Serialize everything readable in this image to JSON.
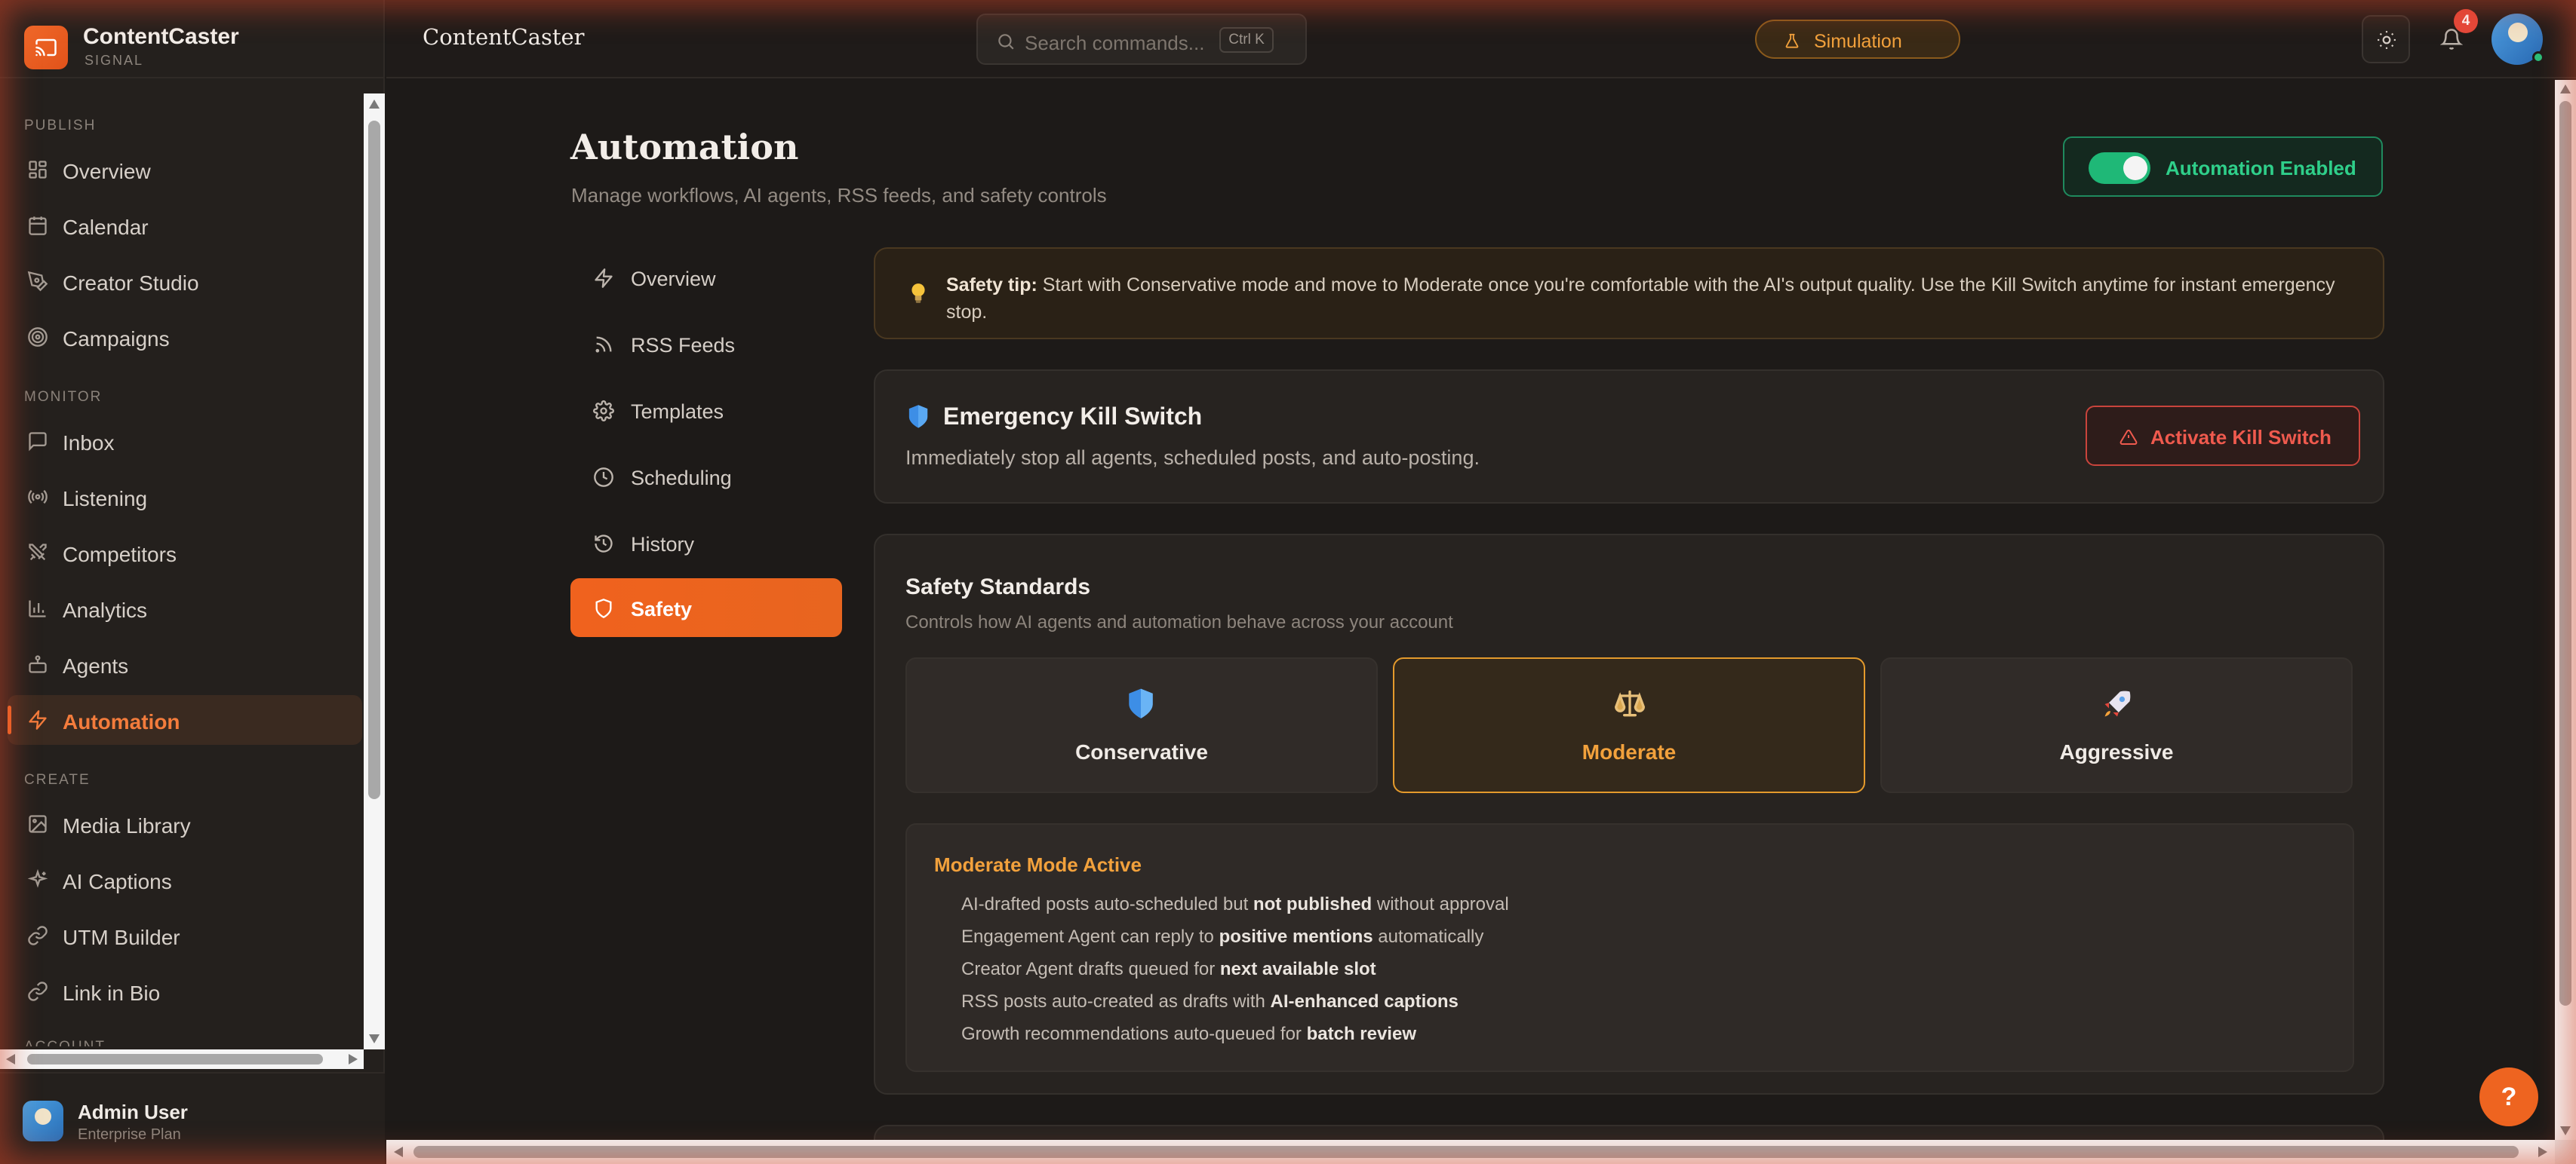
{
  "brand": {
    "name": "ContentCaster",
    "subtitle": "SIGNAL"
  },
  "sidebar": {
    "sections": [
      {
        "label": "PUBLISH"
      },
      {
        "label": "MONITOR"
      },
      {
        "label": "CREATE"
      },
      {
        "label": "ACCOUNT"
      }
    ],
    "items": [
      {
        "label": "Overview",
        "icon": "layout-grid-icon"
      },
      {
        "label": "Calendar",
        "icon": "calendar-icon"
      },
      {
        "label": "Creator Studio",
        "icon": "pen-tool-icon"
      },
      {
        "label": "Campaigns",
        "icon": "target-icon"
      },
      {
        "label": "Inbox",
        "icon": "message-square-icon"
      },
      {
        "label": "Listening",
        "icon": "radio-icon"
      },
      {
        "label": "Competitors",
        "icon": "swords-icon"
      },
      {
        "label": "Analytics",
        "icon": "bar-chart-icon"
      },
      {
        "label": "Agents",
        "icon": "bot-icon"
      },
      {
        "label": "Automation",
        "icon": "zap-icon",
        "active": true
      },
      {
        "label": "Media Library",
        "icon": "image-icon"
      },
      {
        "label": "AI Captions",
        "icon": "sparkles-icon"
      },
      {
        "label": "UTM Builder",
        "icon": "link-icon"
      },
      {
        "label": "Link in Bio",
        "icon": "link-icon"
      }
    ],
    "user": {
      "name": "Admin User",
      "plan": "Enterprise Plan"
    }
  },
  "topbar": {
    "title": "ContentCaster",
    "search_placeholder": "Search commands...",
    "search_shortcut": "Ctrl K",
    "mode_pill": "Simulation",
    "notifications_count": "4"
  },
  "page": {
    "title": "Automation",
    "subtitle": "Manage workflows, AI agents, RSS feeds, and safety controls",
    "toggle_label": "Automation Enabled",
    "toggle_on": true
  },
  "subnav": [
    {
      "label": "Overview",
      "icon": "zap-icon"
    },
    {
      "label": "RSS Feeds",
      "icon": "rss-icon"
    },
    {
      "label": "Templates",
      "icon": "gear-icon"
    },
    {
      "label": "Scheduling",
      "icon": "clock-icon"
    },
    {
      "label": "History",
      "icon": "history-icon"
    },
    {
      "label": "Safety",
      "icon": "shield-icon",
      "active": true
    }
  ],
  "tip": {
    "strong": "Safety tip:",
    "text": " Start with Conservative mode and move to Moderate once you're comfortable with the AI's output quality. Use the Kill Switch anytime for instant emergency stop."
  },
  "kill_switch": {
    "title": "Emergency Kill Switch",
    "description": "Immediately stop all agents, scheduled posts, and auto-posting.",
    "button": "Activate Kill Switch"
  },
  "safety": {
    "title": "Safety Standards",
    "description": "Controls how AI agents and automation behave across your account",
    "modes": [
      {
        "label": "Conservative",
        "icon": "shield-icon"
      },
      {
        "label": "Moderate",
        "icon": "scales-icon",
        "selected": true
      },
      {
        "label": "Aggressive",
        "icon": "rocket-icon"
      }
    ],
    "active_title": "Moderate Mode Active",
    "lines": [
      {
        "pre": "AI-drafted posts auto-scheduled but ",
        "bold": "not published",
        "post": " without approval"
      },
      {
        "pre": "Engagement Agent can reply to ",
        "bold": "positive mentions",
        "post": " automatically"
      },
      {
        "pre": "Creator Agent drafts queued for ",
        "bold": "next available slot",
        "post": ""
      },
      {
        "pre": "RSS posts auto-created as drafts with ",
        "bold": "AI-enhanced captions",
        "post": ""
      },
      {
        "pre": "Growth recommendations auto-queued for ",
        "bold": "batch review",
        "post": ""
      }
    ]
  },
  "help_label": "?",
  "colors": {
    "accent": "#f26a2a",
    "success": "#1fb877",
    "danger": "#ef5a4e",
    "warning": "#f2a13c"
  }
}
